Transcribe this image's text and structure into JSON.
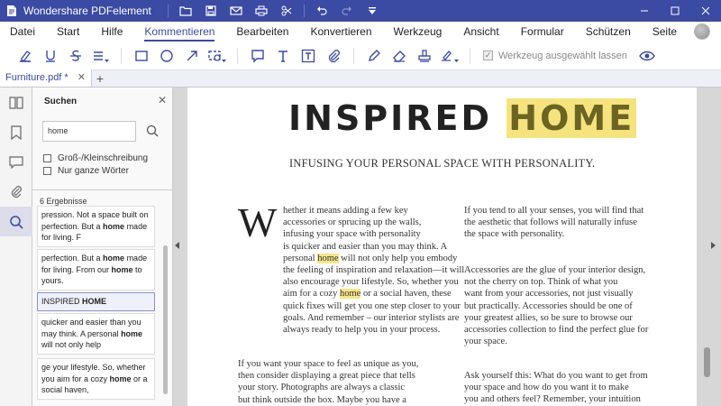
{
  "app": {
    "title": "Wondershare PDFelement"
  },
  "menu": [
    "Datei",
    "Start",
    "Hilfe",
    "Kommentieren",
    "Bearbeiten",
    "Konvertieren",
    "Werkzeug",
    "Ansicht",
    "Formular",
    "Schützen",
    "Seite"
  ],
  "menu_active": "Kommentieren",
  "toolbar": {
    "keep_tool_label": "Werkzeug ausgewählt lassen"
  },
  "tab": {
    "label": "Furniture.pdf *"
  },
  "search": {
    "title": "Suchen",
    "value": "home",
    "option_case": "Groß-/Kleinschreibung",
    "option_whole": "Nur ganze Wörter",
    "results_count": "6 Ergebnisse",
    "results": [
      {
        "lines": [
          [
            [
              "pression. Not a space built on",
              false
            ]
          ],
          [
            [
              "perfection. But a ",
              false
            ],
            [
              "home",
              true
            ],
            [
              " made",
              false
            ]
          ],
          [
            [
              "for living. F",
              false
            ]
          ]
        ]
      },
      {
        "lines": [
          [
            [
              "perfection. But a ",
              false
            ],
            [
              "home",
              true
            ],
            [
              " made",
              false
            ]
          ],
          [
            [
              "for living. From our ",
              false
            ],
            [
              "home",
              true
            ],
            [
              " to",
              false
            ]
          ],
          [
            [
              "yours.",
              false
            ]
          ]
        ]
      },
      {
        "lines": [
          [
            [
              "INSPIRED ",
              false
            ],
            [
              "HOME",
              true
            ]
          ]
        ],
        "selected": true
      },
      {
        "lines": [
          [
            [
              "quicker and easier than you",
              false
            ]
          ],
          [
            [
              "may think. A personal ",
              false
            ],
            [
              "home",
              true
            ]
          ],
          [
            [
              "will not only help",
              false
            ]
          ]
        ]
      },
      {
        "lines": [
          [
            [
              "ge your lifestyle. So, whether",
              false
            ]
          ],
          [
            [
              "you aim for a cozy ",
              false
            ],
            [
              "home",
              true
            ],
            [
              " or a",
              false
            ]
          ],
          [
            [
              "social haven,",
              false
            ]
          ]
        ]
      }
    ]
  },
  "document": {
    "title_part1": "INSPIRED ",
    "title_part2": "HOME",
    "subtitle": "INFUSING YOUR PERSONAL SPACE WITH PERSONALITY.",
    "dropcap": "W",
    "col1_para1": [
      [
        [
          "hether it means adding a few key",
          false
        ]
      ],
      [
        [
          "accessories or sprucing up the walls,",
          false
        ]
      ],
      [
        [
          "infusing your space with personality",
          false
        ]
      ],
      [
        [
          "is quicker and easier than you may think. A",
          false
        ]
      ],
      [
        [
          "personal ",
          false
        ],
        [
          "home",
          true
        ],
        [
          " will not only help you embody",
          false
        ]
      ],
      [
        [
          "the feeling of inspiration and relaxation—it will",
          false
        ]
      ],
      [
        [
          "also encourage your lifestyle. So, whether you",
          false
        ]
      ],
      [
        [
          "aim for a cozy ",
          false
        ],
        [
          "home",
          true
        ],
        [
          " or a social haven, these",
          false
        ]
      ],
      [
        [
          "quick fixes will get you one step closer to your",
          false
        ]
      ],
      [
        [
          "goals. And remember – our interior stylists are",
          false
        ]
      ],
      [
        [
          "always ready to help you in your process.",
          false
        ]
      ]
    ],
    "col1_para2": [
      [
        [
          "If you want your space to feel as unique as you,",
          false
        ]
      ],
      [
        [
          "then consider displaying a great piece that tells",
          false
        ]
      ],
      [
        [
          "your story. Photographs are always a classic",
          false
        ]
      ],
      [
        [
          "but think outside the box. Maybe you have a",
          false
        ]
      ]
    ],
    "col2_para1": [
      [
        [
          "If you tend to all your senses, you will find that",
          false
        ]
      ],
      [
        [
          "the aesthetic that follows will naturally infuse",
          false
        ]
      ],
      [
        [
          "the space with personality.",
          false
        ]
      ]
    ],
    "col2_para2": [
      [
        [
          "Accessories are the glue of your interior design,",
          false
        ]
      ],
      [
        [
          "not the cherry on top. Think of what you",
          false
        ]
      ],
      [
        [
          "want from your accessories, not just visually",
          false
        ]
      ],
      [
        [
          "but practically. Accessories should be one of",
          false
        ]
      ],
      [
        [
          "your greatest allies, so be sure to browse our",
          false
        ]
      ],
      [
        [
          "accessories collection to find the perfect glue for",
          false
        ]
      ],
      [
        [
          "your space.",
          false
        ]
      ]
    ],
    "col2_para3": [
      [
        [
          "Ask yourself this: What do you want to get from",
          false
        ]
      ],
      [
        [
          "your space and how do you want it to make",
          false
        ]
      ],
      [
        [
          "you and others feel? Remember, your intuition",
          false
        ]
      ]
    ]
  },
  "colors": {
    "brand": "#3b4aa3",
    "highlight": "#f5e37e"
  }
}
